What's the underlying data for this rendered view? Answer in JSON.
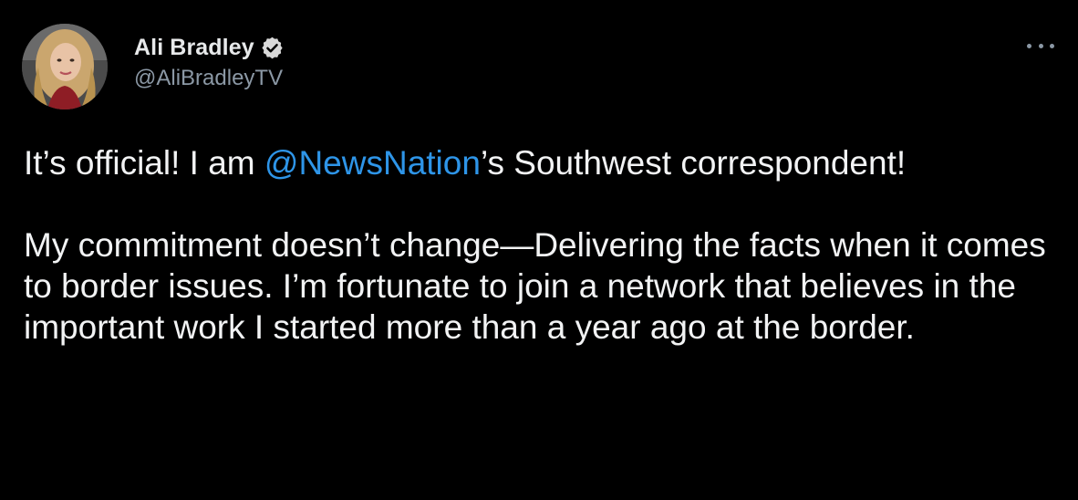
{
  "tweet": {
    "author": {
      "display_name": "Ali Bradley",
      "handle": "@AliBradleyTV",
      "verified": true,
      "avatar_icon": "profile-photo"
    },
    "more_icon": "more-dots-icon",
    "text": {
      "line1_pre": "It’s official! I am ",
      "mention": "@NewsNation",
      "line1_post": "’s Southwest correspondent!",
      "paragraph2": "My commitment doesn’t change—Delivering the facts when it comes to border issues. I’m fortunate to join a network that believes in the important work I started more than a year ago at the border."
    }
  },
  "colors": {
    "background": "#000000",
    "text": "#e7e9ea",
    "secondary": "#8b98a5",
    "link": "#1d9bf0",
    "verified_badge": "#d9d9d9"
  }
}
